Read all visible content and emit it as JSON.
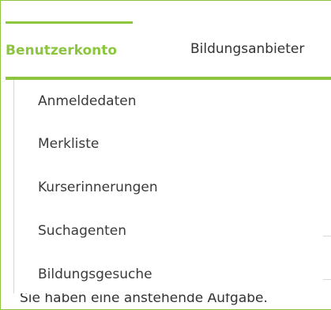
{
  "tabs": {
    "active_label": "Benutzerkonto",
    "second_label": "Bildungsanbieter"
  },
  "menu": {
    "items": [
      {
        "label": "Anmeldedaten"
      },
      {
        "label": "Merkliste"
      },
      {
        "label": "Kurserinnerungen"
      },
      {
        "label": "Suchagenten"
      },
      {
        "label": "Bildungsgesuche"
      }
    ]
  },
  "background": {
    "task_notice": "Sie haben eine anstehende Aufgabe."
  },
  "colors": {
    "accent": "#8cc63f",
    "text": "#333333",
    "border": "#d6d6d6"
  }
}
